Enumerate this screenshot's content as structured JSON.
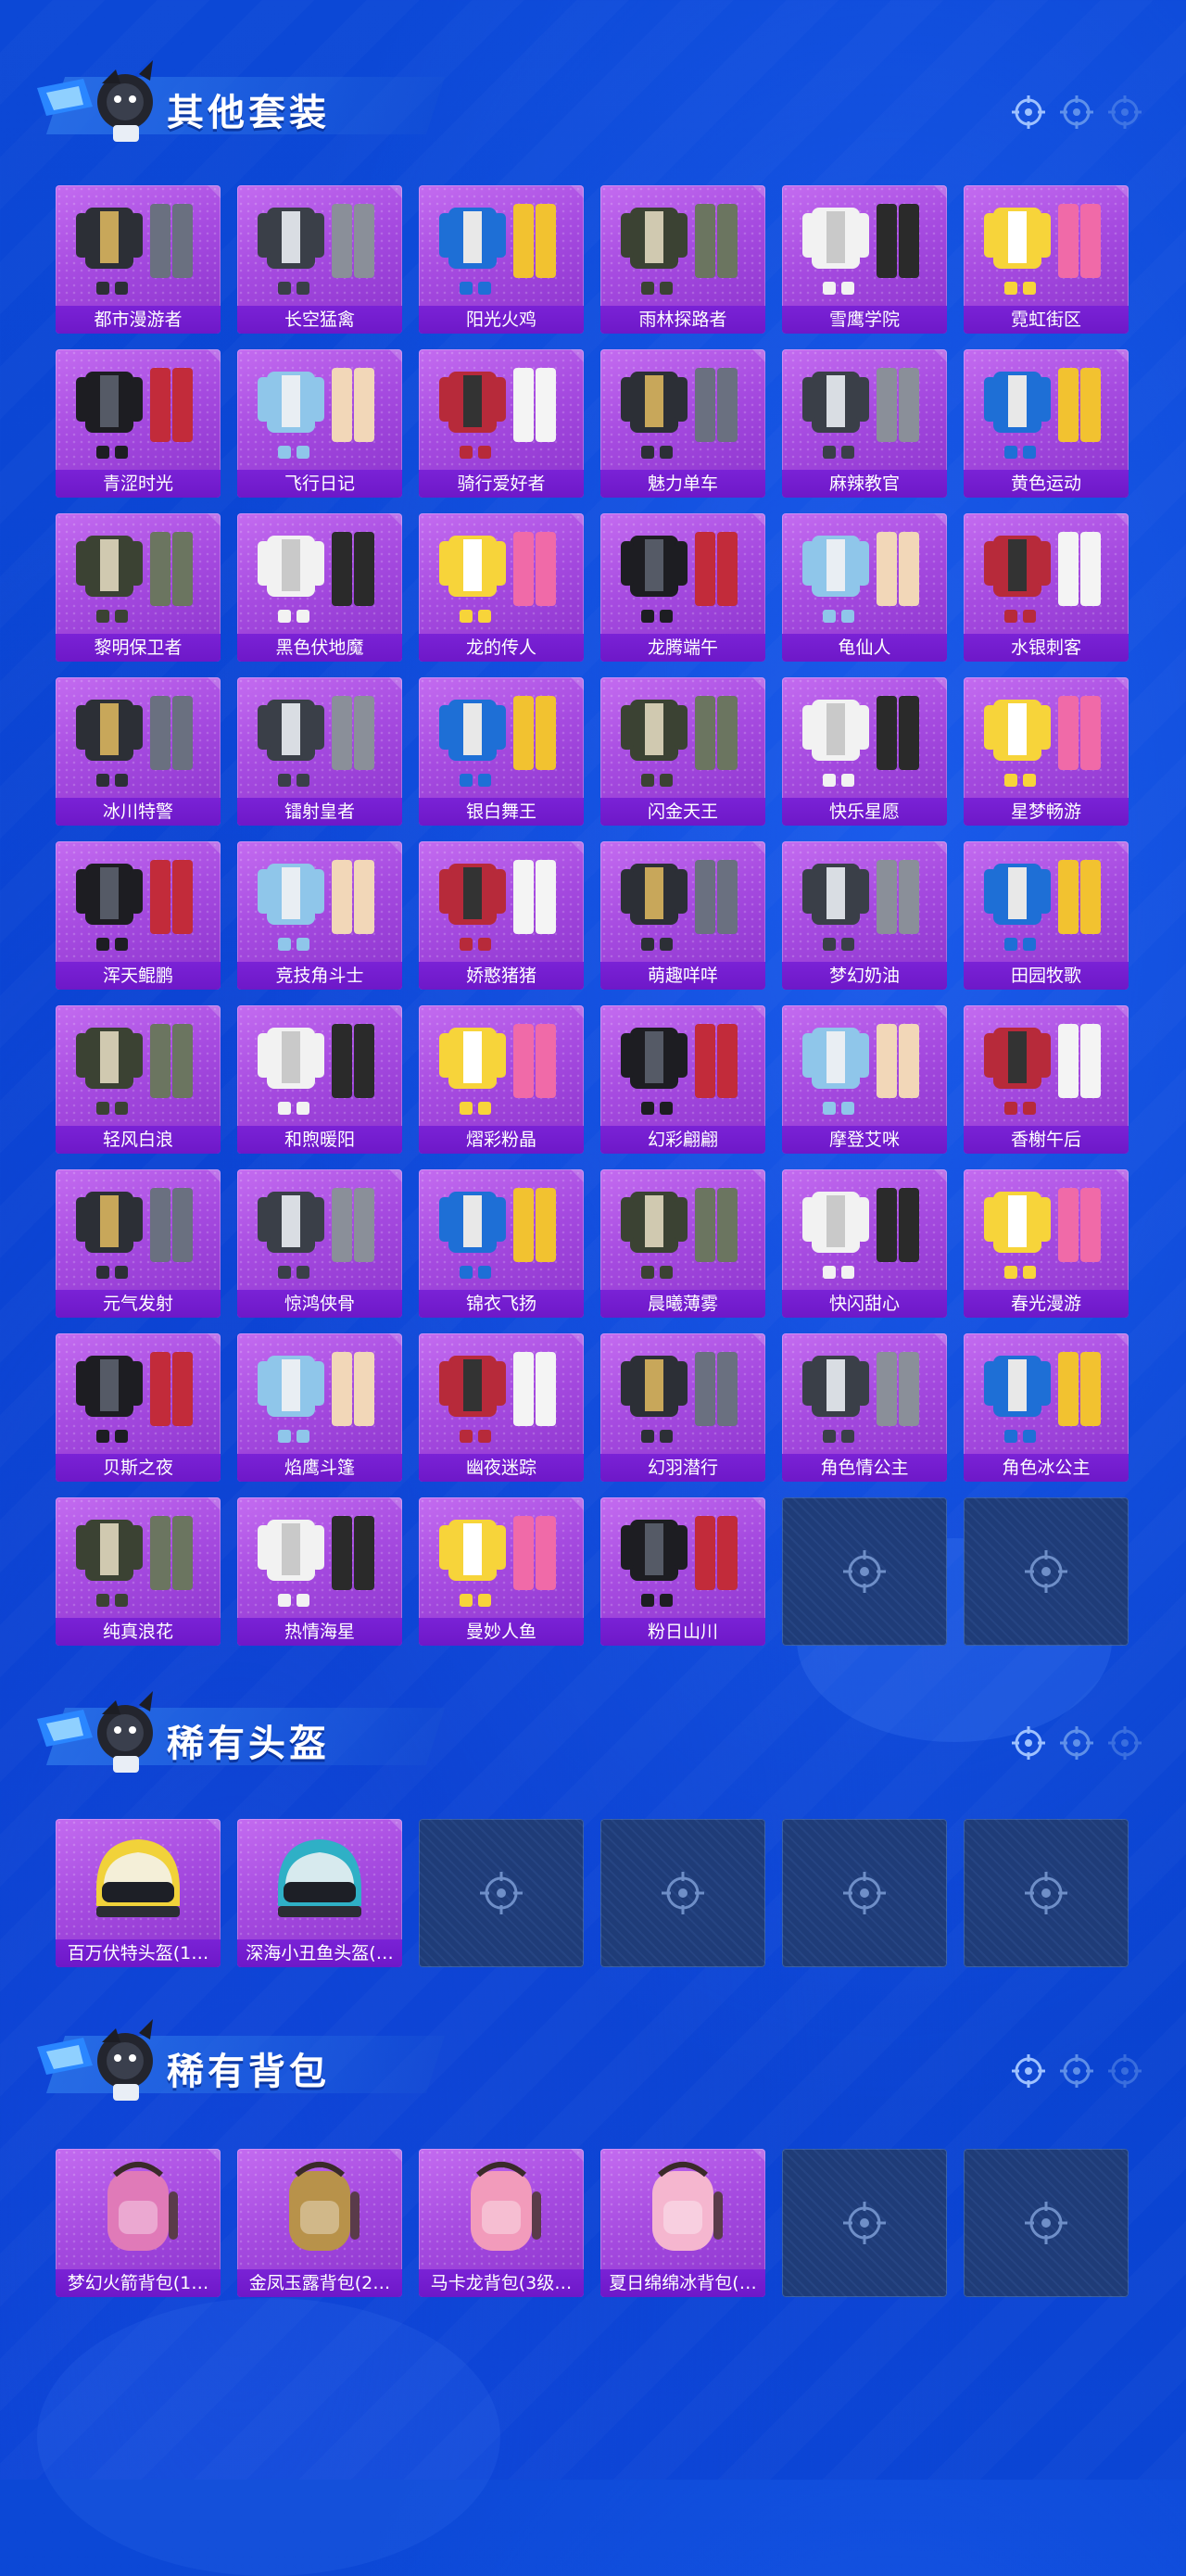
{
  "colors": {
    "background": "#0a44d2",
    "card_purple": "#a64be0",
    "card_label": "#6e18c8",
    "empty_slot": "#1f3c78"
  },
  "sections": [
    {
      "title": "其他套装",
      "items": [
        "都市漫游者",
        "长空猛禽",
        "阳光火鸡",
        "雨林探路者",
        "雪鹰学院",
        "霓虹街区",
        "青涩时光",
        "飞行日记",
        "骑行爱好者",
        "魅力单车",
        "麻辣教官",
        "黄色运动",
        "黎明保卫者",
        "黑色伏地魔",
        "龙的传人",
        "龙腾端午",
        "龟仙人",
        "水银刺客",
        "冰川特警",
        "镭射皇者",
        "银白舞王",
        "闪金天王",
        "快乐星愿",
        "星梦畅游",
        "浑天鲲鹏",
        "竞技角斗士",
        "娇憨猪猪",
        "萌趣咩咩",
        "梦幻奶油",
        "田园牧歌",
        "轻风白浪",
        "和煦暖阳",
        "熠彩粉晶",
        "幻彩翩翩",
        "摩登艾咪",
        "香榭午后",
        "元气发射",
        "惊鸿侠骨",
        "锦衣飞扬",
        "晨曦薄雾",
        "快闪甜心",
        "春光漫游",
        "贝斯之夜",
        "焰鹰斗篷",
        "幽夜迷踪",
        "幻羽潜行",
        "角色情公主",
        "角色冰公主",
        "纯真浪花",
        "热情海星",
        "曼妙人鱼",
        "粉日山川"
      ],
      "empty_slots": 2
    },
    {
      "title": "稀有头盔",
      "items": [
        "百万伏特头盔(1…",
        "深海小丑鱼头盔(…"
      ],
      "empty_slots": 4
    },
    {
      "title": "稀有背包",
      "items": [
        "梦幻火箭背包(1…",
        "金凤玉露背包(2…",
        "马卡龙背包(3级…",
        "夏日绵绵冰背包(…"
      ],
      "empty_slots": 2
    }
  ]
}
